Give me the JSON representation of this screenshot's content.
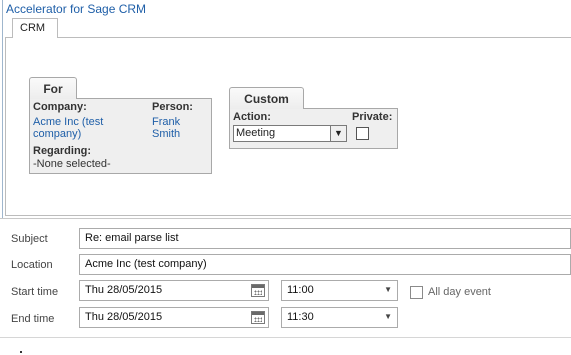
{
  "app": {
    "title": "Accelerator for Sage CRM"
  },
  "tabs": [
    {
      "label": "CRM"
    }
  ],
  "for_group": {
    "title": "For",
    "company_label": "Company:",
    "company_value_line1": "Acme Inc (test",
    "company_value_line2": "company)",
    "person_label": "Person:",
    "person_value_line1": "Frank",
    "person_value_line2": "Smith",
    "regarding_label": "Regarding:",
    "regarding_value": "-None selected-"
  },
  "custom_group": {
    "title": "Custom",
    "action_label": "Action:",
    "action_selected": "Meeting",
    "private_label": "Private:",
    "private_checked": false
  },
  "form": {
    "subject_label": "Subject",
    "subject_value": "Re: email parse list",
    "location_label": "Location",
    "location_value": "Acme Inc (test company)",
    "start_label": "Start time",
    "start_date": "Thu 28/05/2015",
    "start_time": "11:00",
    "all_day_label": "All day event",
    "all_day_checked": false,
    "end_label": "End time",
    "end_date": "Thu 28/05/2015",
    "end_time": "11:30"
  },
  "colors": {
    "link": "#1f5fa8",
    "group_bg": "#efefef",
    "border": "#bcbcbc"
  },
  "icons": [
    "calendar-icon",
    "chevron-down-icon"
  ]
}
